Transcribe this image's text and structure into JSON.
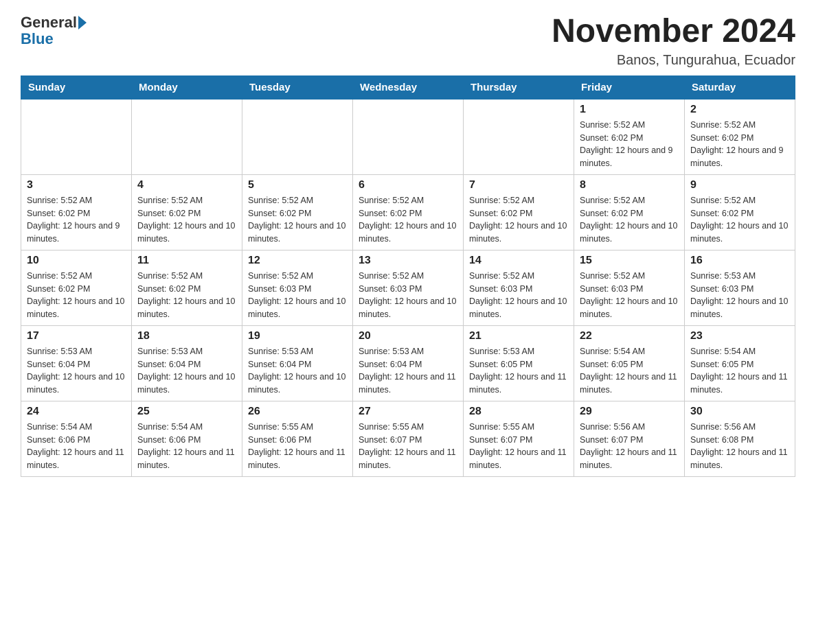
{
  "logo": {
    "general": "General",
    "blue": "Blue"
  },
  "header": {
    "title": "November 2024",
    "subtitle": "Banos, Tungurahua, Ecuador"
  },
  "days_of_week": [
    "Sunday",
    "Monday",
    "Tuesday",
    "Wednesday",
    "Thursday",
    "Friday",
    "Saturday"
  ],
  "weeks": [
    [
      {
        "day": "",
        "info": ""
      },
      {
        "day": "",
        "info": ""
      },
      {
        "day": "",
        "info": ""
      },
      {
        "day": "",
        "info": ""
      },
      {
        "day": "",
        "info": ""
      },
      {
        "day": "1",
        "info": "Sunrise: 5:52 AM\nSunset: 6:02 PM\nDaylight: 12 hours and 9 minutes."
      },
      {
        "day": "2",
        "info": "Sunrise: 5:52 AM\nSunset: 6:02 PM\nDaylight: 12 hours and 9 minutes."
      }
    ],
    [
      {
        "day": "3",
        "info": "Sunrise: 5:52 AM\nSunset: 6:02 PM\nDaylight: 12 hours and 9 minutes."
      },
      {
        "day": "4",
        "info": "Sunrise: 5:52 AM\nSunset: 6:02 PM\nDaylight: 12 hours and 10 minutes."
      },
      {
        "day": "5",
        "info": "Sunrise: 5:52 AM\nSunset: 6:02 PM\nDaylight: 12 hours and 10 minutes."
      },
      {
        "day": "6",
        "info": "Sunrise: 5:52 AM\nSunset: 6:02 PM\nDaylight: 12 hours and 10 minutes."
      },
      {
        "day": "7",
        "info": "Sunrise: 5:52 AM\nSunset: 6:02 PM\nDaylight: 12 hours and 10 minutes."
      },
      {
        "day": "8",
        "info": "Sunrise: 5:52 AM\nSunset: 6:02 PM\nDaylight: 12 hours and 10 minutes."
      },
      {
        "day": "9",
        "info": "Sunrise: 5:52 AM\nSunset: 6:02 PM\nDaylight: 12 hours and 10 minutes."
      }
    ],
    [
      {
        "day": "10",
        "info": "Sunrise: 5:52 AM\nSunset: 6:02 PM\nDaylight: 12 hours and 10 minutes."
      },
      {
        "day": "11",
        "info": "Sunrise: 5:52 AM\nSunset: 6:02 PM\nDaylight: 12 hours and 10 minutes."
      },
      {
        "day": "12",
        "info": "Sunrise: 5:52 AM\nSunset: 6:03 PM\nDaylight: 12 hours and 10 minutes."
      },
      {
        "day": "13",
        "info": "Sunrise: 5:52 AM\nSunset: 6:03 PM\nDaylight: 12 hours and 10 minutes."
      },
      {
        "day": "14",
        "info": "Sunrise: 5:52 AM\nSunset: 6:03 PM\nDaylight: 12 hours and 10 minutes."
      },
      {
        "day": "15",
        "info": "Sunrise: 5:52 AM\nSunset: 6:03 PM\nDaylight: 12 hours and 10 minutes."
      },
      {
        "day": "16",
        "info": "Sunrise: 5:53 AM\nSunset: 6:03 PM\nDaylight: 12 hours and 10 minutes."
      }
    ],
    [
      {
        "day": "17",
        "info": "Sunrise: 5:53 AM\nSunset: 6:04 PM\nDaylight: 12 hours and 10 minutes."
      },
      {
        "day": "18",
        "info": "Sunrise: 5:53 AM\nSunset: 6:04 PM\nDaylight: 12 hours and 10 minutes."
      },
      {
        "day": "19",
        "info": "Sunrise: 5:53 AM\nSunset: 6:04 PM\nDaylight: 12 hours and 10 minutes."
      },
      {
        "day": "20",
        "info": "Sunrise: 5:53 AM\nSunset: 6:04 PM\nDaylight: 12 hours and 11 minutes."
      },
      {
        "day": "21",
        "info": "Sunrise: 5:53 AM\nSunset: 6:05 PM\nDaylight: 12 hours and 11 minutes."
      },
      {
        "day": "22",
        "info": "Sunrise: 5:54 AM\nSunset: 6:05 PM\nDaylight: 12 hours and 11 minutes."
      },
      {
        "day": "23",
        "info": "Sunrise: 5:54 AM\nSunset: 6:05 PM\nDaylight: 12 hours and 11 minutes."
      }
    ],
    [
      {
        "day": "24",
        "info": "Sunrise: 5:54 AM\nSunset: 6:06 PM\nDaylight: 12 hours and 11 minutes."
      },
      {
        "day": "25",
        "info": "Sunrise: 5:54 AM\nSunset: 6:06 PM\nDaylight: 12 hours and 11 minutes."
      },
      {
        "day": "26",
        "info": "Sunrise: 5:55 AM\nSunset: 6:06 PM\nDaylight: 12 hours and 11 minutes."
      },
      {
        "day": "27",
        "info": "Sunrise: 5:55 AM\nSunset: 6:07 PM\nDaylight: 12 hours and 11 minutes."
      },
      {
        "day": "28",
        "info": "Sunrise: 5:55 AM\nSunset: 6:07 PM\nDaylight: 12 hours and 11 minutes."
      },
      {
        "day": "29",
        "info": "Sunrise: 5:56 AM\nSunset: 6:07 PM\nDaylight: 12 hours and 11 minutes."
      },
      {
        "day": "30",
        "info": "Sunrise: 5:56 AM\nSunset: 6:08 PM\nDaylight: 12 hours and 11 minutes."
      }
    ]
  ]
}
